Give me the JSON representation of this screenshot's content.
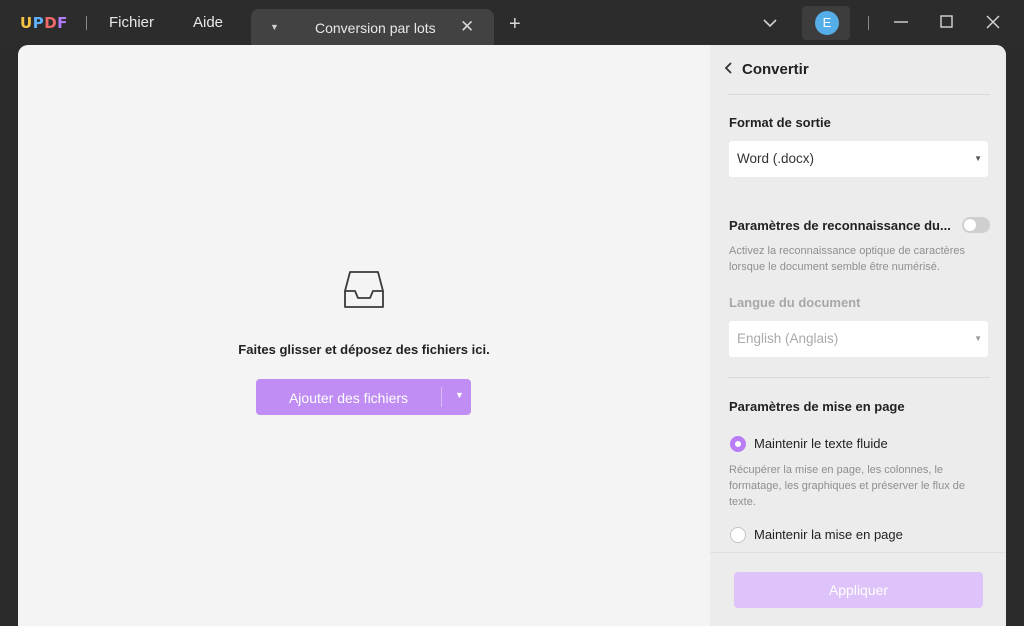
{
  "app": {
    "logo_text": {
      "u": "U",
      "p": "P",
      "d": "D",
      "f": "F"
    },
    "menu": [
      "Fichier",
      "Aide"
    ],
    "tab": {
      "label": "Conversion par lots"
    },
    "user_initial": "E",
    "colors": {
      "accent": "#bf8df3",
      "titlebar": "#2c2c2c",
      "avatar": "#56aee8"
    }
  },
  "dropzone": {
    "icon": "inbox-tray-icon",
    "text": "Faites glisser et déposez des fichiers ici.",
    "add_button_label": "Ajouter des fichiers"
  },
  "panel": {
    "title": "Convertir",
    "output_format": {
      "label": "Format de sortie",
      "value": "Word (.docx)"
    },
    "ocr": {
      "label": "Paramètres de reconnaissance du...",
      "enabled": false,
      "description": "Activez la reconnaissance optique de caractères lorsque le document semble être numérisé."
    },
    "language": {
      "label": "Langue du document",
      "value": "English (Anglais)"
    },
    "layout": {
      "label": "Paramètres de mise en page",
      "option1": "Maintenir le texte fluide",
      "option1_selected": true,
      "option1_desc": "Récupérer la mise en page, les colonnes, le formatage, les graphiques et préserver le flux de texte.",
      "option2": "Maintenir la mise en page"
    },
    "apply_label": "Appliquer"
  }
}
